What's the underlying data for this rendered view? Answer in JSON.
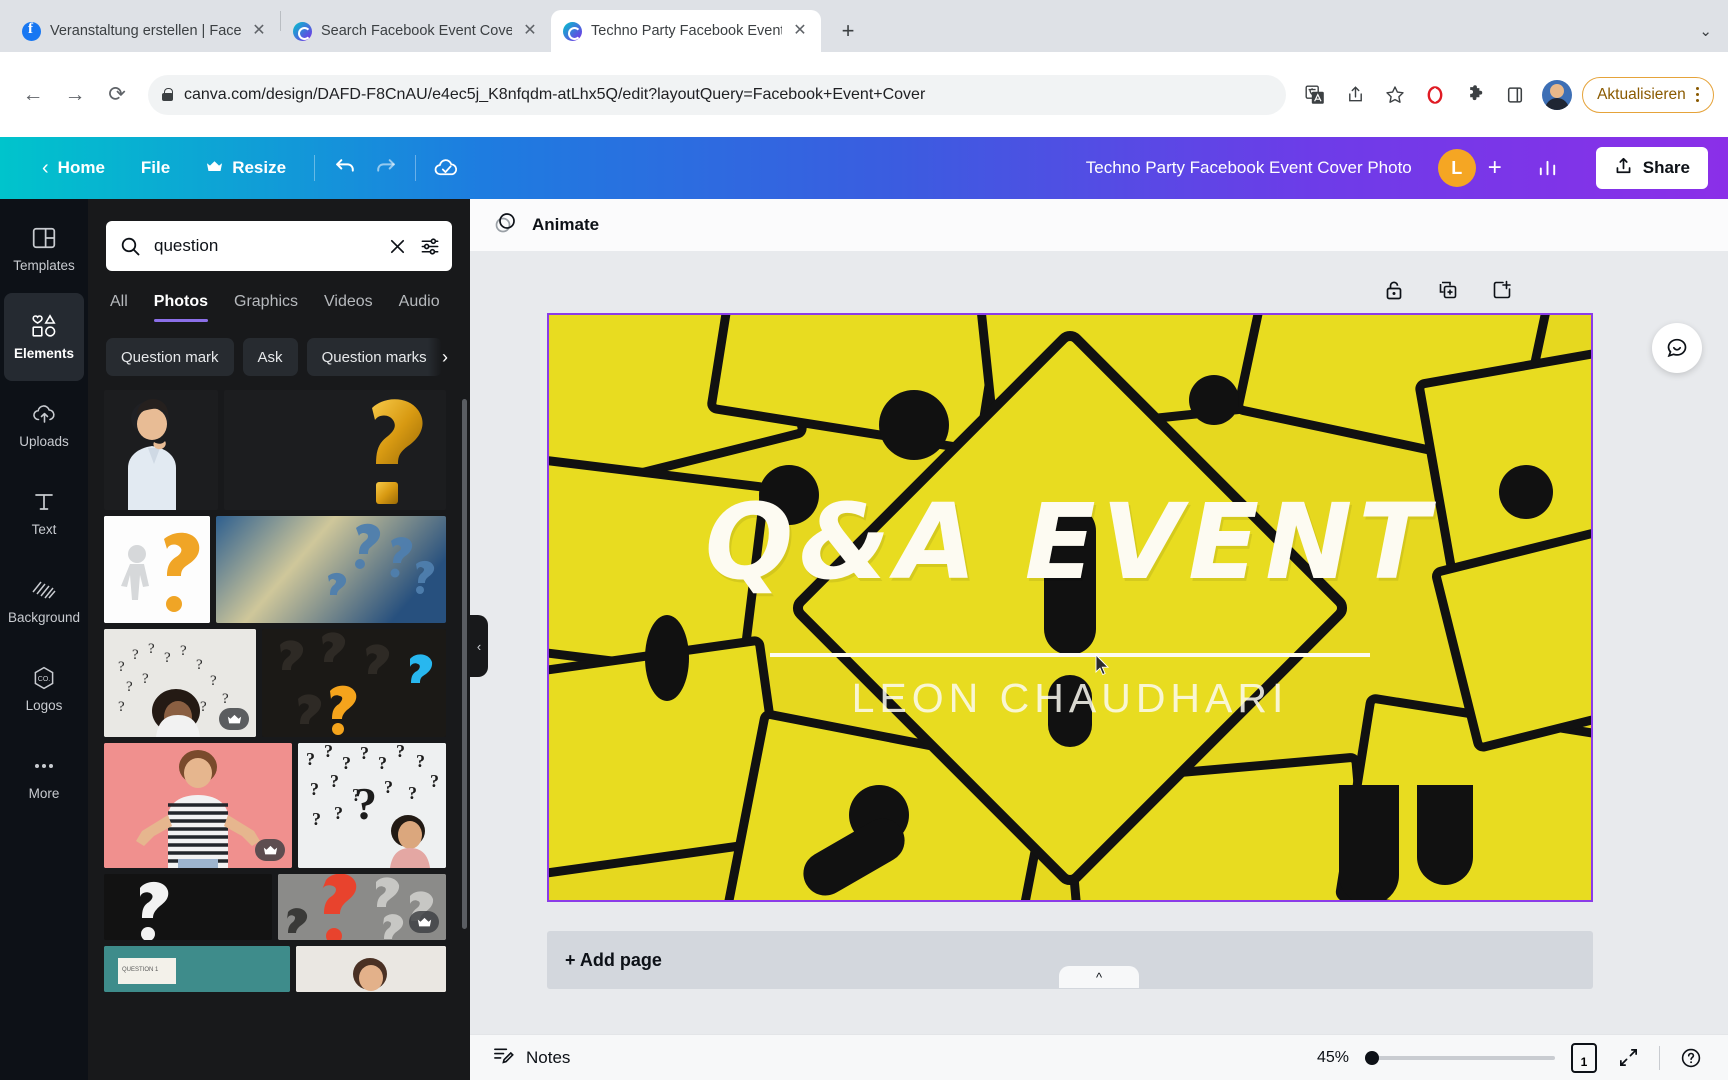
{
  "browser": {
    "tabs": [
      {
        "title": "Veranstaltung erstellen | Faceb",
        "favicon": "facebook-icon",
        "active": false
      },
      {
        "title": "Search Facebook Event Cover",
        "favicon": "canva-icon",
        "active": false
      },
      {
        "title": "Techno Party Facebook Event C",
        "favicon": "canva-icon",
        "active": true
      }
    ],
    "new_tab_label": "+",
    "tab_list_chevron": "chevron-down-icon",
    "url": "canva.com/design/DAFD-F8CnAU/e4ec5j_K8nfqdm-atLhx5Q/edit?layoutQuery=Facebook+Event+Cover",
    "back_label": "←",
    "forward_label": "→",
    "reload_label": "⟳",
    "omni_icons": [
      "translate-icon",
      "share-icon",
      "bookmark-star-icon",
      "opera-extension-icon",
      "puzzle-extension-icon",
      "sidepanel-icon"
    ],
    "update_button": "Aktualisieren"
  },
  "canva_top": {
    "back_chevron": "chevron-left-icon",
    "home": "Home",
    "file": "File",
    "resize": "Resize",
    "resize_crown": "crown-icon",
    "undo": "undo-icon",
    "redo": "redo-icon",
    "saved": "cloud-check-icon",
    "doc_title": "Techno Party Facebook Event Cover Photo",
    "user_initial": "L",
    "invite_plus": "+",
    "insights": "insights-icon",
    "share": "Share",
    "share_icon": "upload-icon"
  },
  "rail": {
    "items": [
      {
        "label": "Templates",
        "icon": "templates-icon",
        "active": false
      },
      {
        "label": "Elements",
        "icon": "elements-icon",
        "active": true
      },
      {
        "label": "Uploads",
        "icon": "uploads-cloud-icon",
        "active": false
      },
      {
        "label": "Text",
        "icon": "text-T-icon",
        "active": false
      },
      {
        "label": "Background",
        "icon": "background-hatch-icon",
        "active": false
      },
      {
        "label": "Logos",
        "icon": "logos-hex-icon",
        "active": false
      },
      {
        "label": "More",
        "icon": "more-dots-icon",
        "active": false
      }
    ]
  },
  "panel": {
    "search": {
      "value": "question",
      "placeholder": "Search",
      "search_icon": "search-icon",
      "clear_icon": "close-icon",
      "filter_icon": "filter-sliders-icon"
    },
    "tabs": [
      {
        "label": "All",
        "active": false
      },
      {
        "label": "Photos",
        "active": true
      },
      {
        "label": "Graphics",
        "active": false
      },
      {
        "label": "Videos",
        "active": false
      },
      {
        "label": "Audio",
        "active": false
      }
    ],
    "chips": [
      "Question mark",
      "Ask",
      "Question marks"
    ],
    "chips_next_icon": "chevron-right-icon",
    "collapse_icon": "chevron-left-icon",
    "results_alt": [
      "thinking-man-white-shirt",
      "golden-question-mark",
      "3d-figure-orange-question-mark",
      "blue-question-marks-wall",
      "woman-with-drawn-question-marks",
      "dark-question-marks-orange-glow",
      "woman-shrugging-pink-background",
      "woman-with-question-marks-white-wall",
      "white-question-mark-dark",
      "red-question-mark-among-grey"
    ]
  },
  "editor": {
    "animate_label": "Animate",
    "animate_icon": "animate-circles-icon",
    "canvas_tools": [
      {
        "name": "unlock-icon"
      },
      {
        "name": "duplicate-icon"
      },
      {
        "name": "add-page-icon"
      }
    ],
    "comment_icon": "comment-icon",
    "design": {
      "title": "Q&A EVENT",
      "subtitle": "LEON CHAUDHARI",
      "background_color": "#e6d81f",
      "accent_color": "#111111",
      "selection_color": "#8b3ce8"
    },
    "add_page_label": "+ Add page",
    "notes_handle_icon": "chevron-up-icon"
  },
  "bottom": {
    "notes_label": "Notes",
    "notes_icon": "notes-icon",
    "zoom_percent": "45%",
    "page_number": "1",
    "expand_icon": "fullscreen-icon",
    "help_icon": "help-icon"
  }
}
